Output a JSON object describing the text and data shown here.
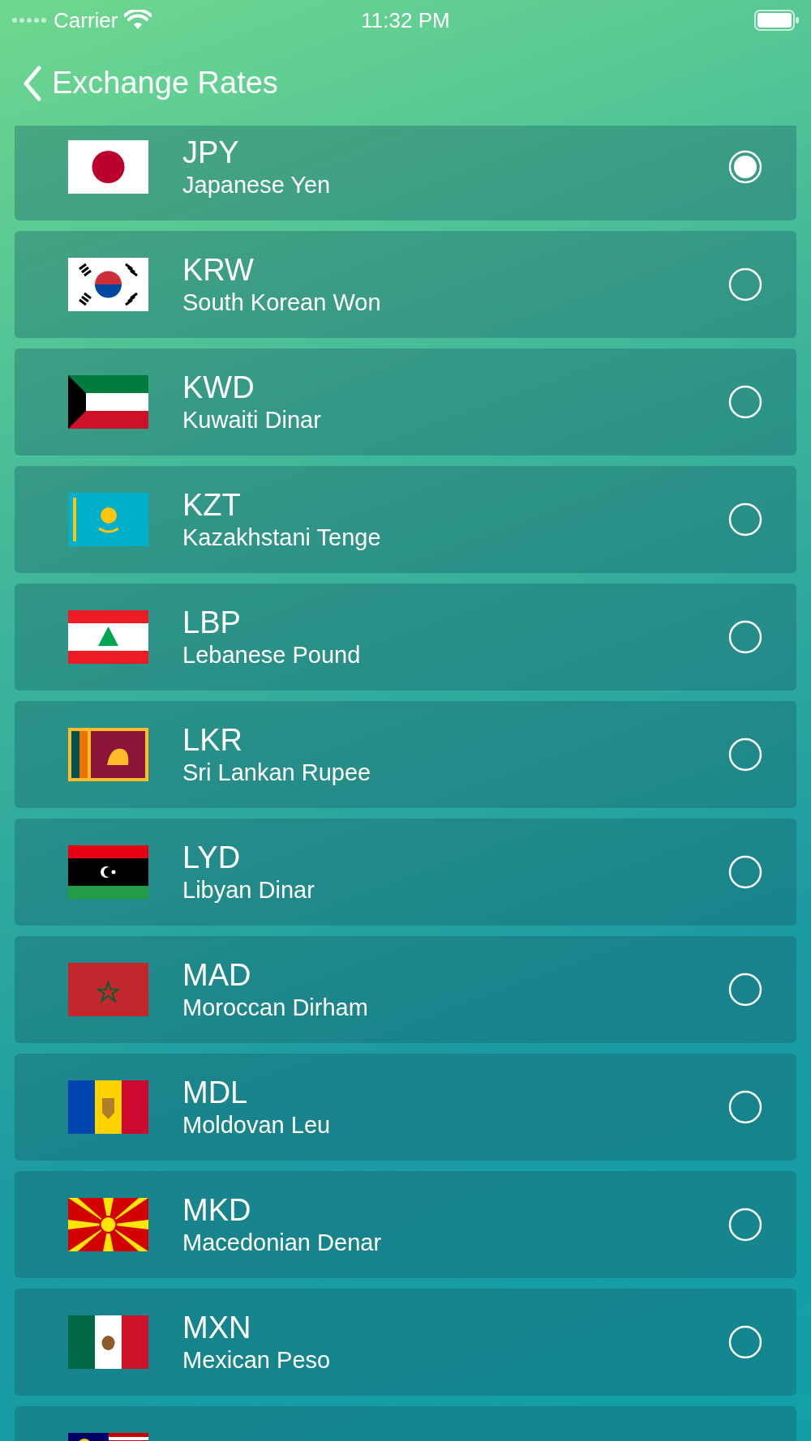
{
  "status_bar": {
    "carrier": "Carrier",
    "time": "11:32 PM"
  },
  "nav": {
    "title": "Exchange Rates"
  },
  "currencies": [
    {
      "code": "JPY",
      "name": "Japanese Yen",
      "kind": "jp",
      "selected": true
    },
    {
      "code": "KRW",
      "name": "South Korean Won",
      "kind": "kr",
      "selected": false
    },
    {
      "code": "KWD",
      "name": "Kuwaiti Dinar",
      "kind": "kw",
      "selected": false
    },
    {
      "code": "KZT",
      "name": "Kazakhstani Tenge",
      "kind": "kz",
      "selected": false
    },
    {
      "code": "LBP",
      "name": "Lebanese Pound",
      "kind": "lb",
      "selected": false
    },
    {
      "code": "LKR",
      "name": "Sri Lankan Rupee",
      "kind": "lk",
      "selected": false
    },
    {
      "code": "LYD",
      "name": "Libyan Dinar",
      "kind": "ly",
      "selected": false
    },
    {
      "code": "MAD",
      "name": "Moroccan Dirham",
      "kind": "ma",
      "selected": false
    },
    {
      "code": "MDL",
      "name": "Moldovan Leu",
      "kind": "md",
      "selected": false
    },
    {
      "code": "MKD",
      "name": "Macedonian Denar",
      "kind": "mk",
      "selected": false
    },
    {
      "code": "MXN",
      "name": "Mexican Peso",
      "kind": "mx",
      "selected": false
    },
    {
      "kind": "my"
    }
  ]
}
